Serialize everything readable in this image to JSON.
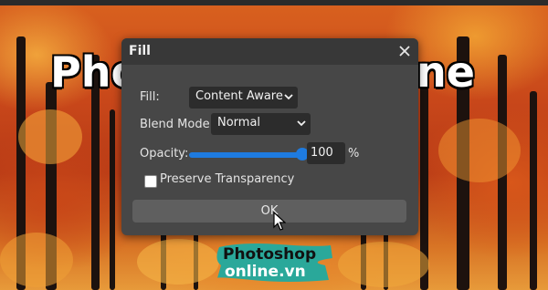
{
  "background": {
    "title_left": "Pho",
    "title_right": "ne"
  },
  "dialog": {
    "title": "Fill",
    "close_icon": "close-icon",
    "fill_label": "Fill:",
    "fill_value": "Content Aware",
    "blend_label": "Blend Mode:",
    "blend_value": "Normal",
    "opacity_label": "Opacity:",
    "opacity_value": "100",
    "opacity_unit": "%",
    "opacity_level": 1.0,
    "preserve_label": "Preserve Transparency",
    "preserve_checked": false,
    "ok_label": "OK"
  },
  "logo": {
    "line1": "Photoshop",
    "line2": "online.vn"
  },
  "colors": {
    "dialog_bg": "#474747",
    "header_bg": "#383838",
    "accent": "#1e7be0",
    "logo_teal": "#2aa89a"
  }
}
